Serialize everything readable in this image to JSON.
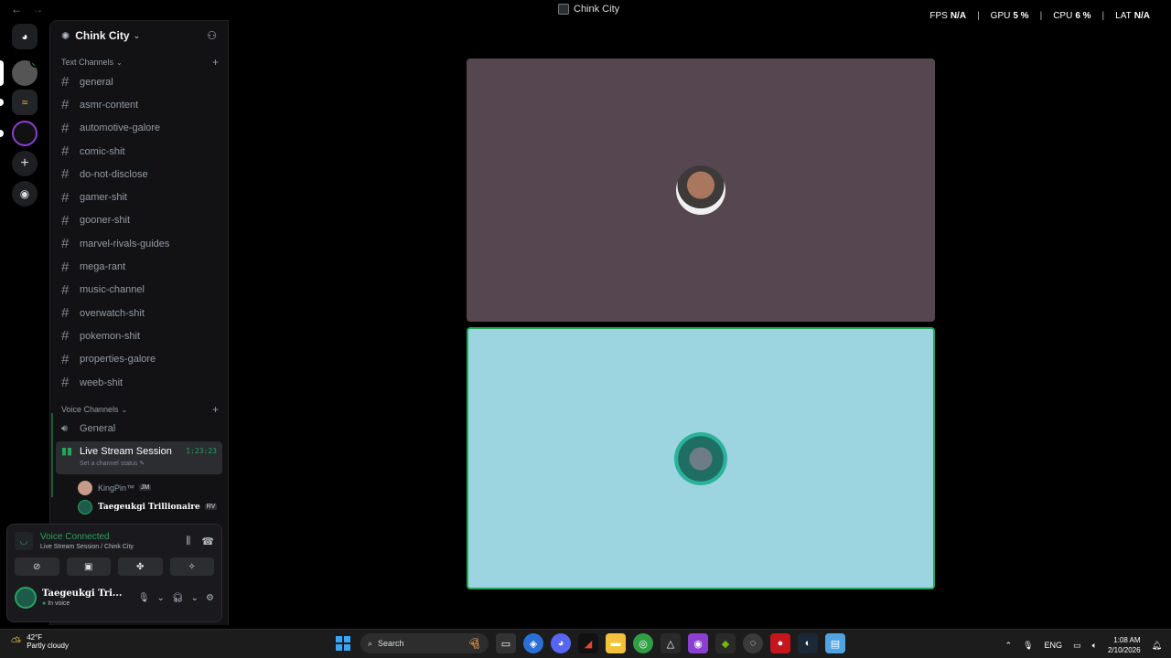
{
  "window": {
    "title": "Chink City",
    "back_glyph": "←",
    "forward_glyph": "→"
  },
  "overlay": {
    "fps_label": "FPS",
    "fps_value": "N/A",
    "gpu_label": "GPU",
    "gpu_value": "5 %",
    "cpu_label": "CPU",
    "cpu_value": "6 %",
    "lat_label": "LAT",
    "lat_value": "N/A"
  },
  "server": {
    "name": "Chink City"
  },
  "categories": {
    "text": "Text Channels",
    "voice": "Voice Channels"
  },
  "text_channels": [
    "general",
    "asmr-content",
    "automotive-galore",
    "comic-shit",
    "do-not-disclose",
    "gamer-shit",
    "gooner-shit",
    "marvel-rivals-guides",
    "mega-rant",
    "music-channel",
    "overwatch-shit",
    "pokemon-shit",
    "properties-galore",
    "weeb-shit"
  ],
  "voice_channels": {
    "general": "General",
    "live": {
      "name": "Live Stream Session",
      "timer": "1:23:23",
      "status": "Set a channel status"
    },
    "users": [
      {
        "name": "KingPin™",
        "tag": "JM"
      },
      {
        "name": "Taegeukgi Trillionaire",
        "tag": "RV"
      }
    ]
  },
  "voice_panel": {
    "title": "Voice Connected",
    "subtitle": "Live Stream Session / Chink City"
  },
  "current_user": {
    "name": "Taegeukgi Tri...",
    "status": "In voice"
  },
  "taskbar": {
    "temp": "42°F",
    "weather": "Partly cloudy",
    "search_placeholder": "Search",
    "lang": "ENG",
    "time": "1:08 AM",
    "date": "2/10/2026"
  },
  "colors": {
    "accent_green": "#23a55a",
    "tile_one": "#56464f",
    "tile_two": "#9cd5e0",
    "sidebar": "#121214"
  },
  "icons": {
    "server_rail": [
      "discord-icon",
      "server-avatar-icon",
      "server-avatar-icon",
      "server-avatar-icon",
      "add-server-icon",
      "explore-icon"
    ]
  }
}
